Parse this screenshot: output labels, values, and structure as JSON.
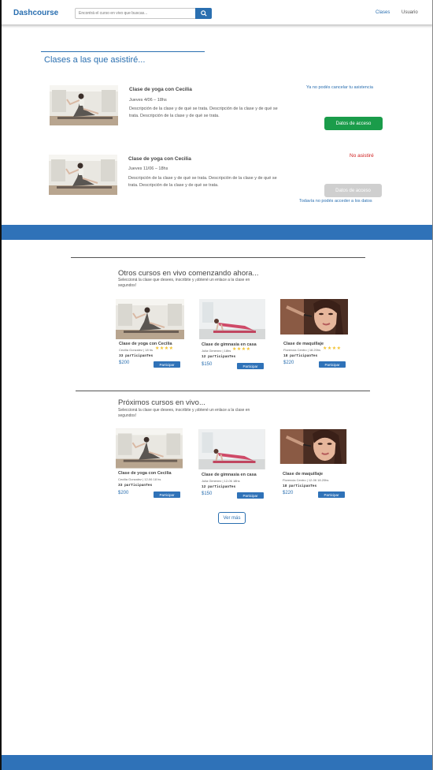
{
  "header": {
    "brand": "Dashcourse",
    "search_placeholder": "Encontrá el curso en vivo que buscas...",
    "search_icon": "search-icon",
    "nav": {
      "clases": "Clases",
      "usuario": "Usuario"
    }
  },
  "attended": {
    "title": "Clases a las que asistiré...",
    "items": [
      {
        "title": "Clase de yoga con Cecilia",
        "date": "Jueves 4/06 – 18hs",
        "description": "Descripción de la clase y de qué se trata. Descripción de la clase y de qué se trata. Descripción de la clase y de qué se trata.",
        "status": "Ya no podés cancelar tu asistencia",
        "button": "Datos de acceso"
      },
      {
        "title": "Clase de yoga con Cecilia",
        "date": "Jueves 11/06 – 18hs",
        "description": "Descripción de la clase y de qué se trata. Descripción de la clase y de qué se trata. Descripción de la clase y de qué se trata.",
        "status": "No asistiré",
        "button": "Datos de acceso",
        "note": "Todavía no podés acceder a los datos"
      }
    ]
  },
  "live_now": {
    "title": "Otros cursos en vivo comenzando ahora...",
    "subtitle": "Seleccioná la clase que desees, inscribite y ¡obtené un enlace a la clase en segundos!",
    "courses": [
      {
        "title": "Clase de yoga con Cecilia",
        "meta": "Cecilia Gonzalez | 18 hs",
        "count": "33 parTicipanTes",
        "price": "$200",
        "button": "Participar",
        "rating": 4
      },
      {
        "title": "Clase de gimnasia en casa",
        "meta": "Julia Gimenez | 18hs",
        "count": "12 parTicipanTes",
        "price": "$150",
        "button": "Participar",
        "rating": 4
      },
      {
        "title": "Clase de maquillaje",
        "meta": "Florencia Centro | 18.20hs",
        "count": "18 parTicipanTes",
        "price": "$220",
        "button": "Participar",
        "rating": 4
      }
    ]
  },
  "upcoming": {
    "title": "Próximos cursos en vivo...",
    "subtitle": "Seleccioná la clase que desees, inscribite y ¡obtené un enlace a la clase en segundos!",
    "courses": [
      {
        "title": "Clase de yoga con Cecilia",
        "meta": "Cecilia Gonzalez | 12-06 18 hs",
        "count": "33 parTicipanTes",
        "price": "$200",
        "button": "Participar"
      },
      {
        "title": "Clase de gimnasia en casa",
        "meta": "Julia Gimenez | 12-06 18hs",
        "count": "12 parTicipanTes",
        "price": "$150",
        "button": "Participar"
      },
      {
        "title": "Clase de maquillaje",
        "meta": "Florencia Centro | 12-06 18.20hs",
        "count": "18 parTicipanTes",
        "price": "$220",
        "button": "Participar"
      }
    ],
    "more": "Ver más"
  },
  "colors": {
    "brand_blue": "#2f72b8",
    "green": "#1a9c4a",
    "red": "#d02020",
    "star": "#f2c230"
  }
}
